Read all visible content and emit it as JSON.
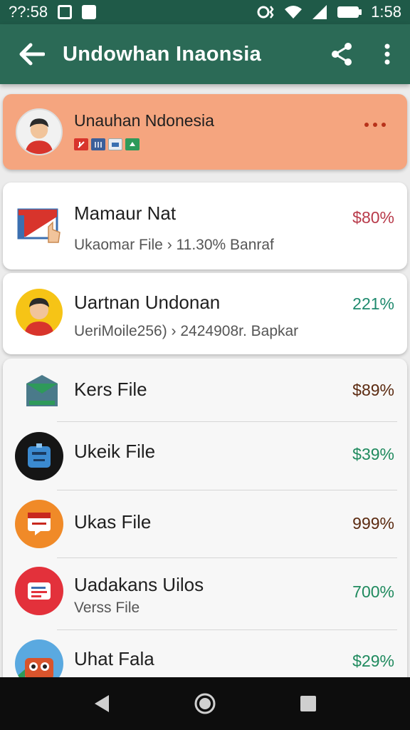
{
  "status_bar": {
    "time_left": "??:58",
    "time_right": "1:58"
  },
  "app_bar": {
    "title": "Undowhan Inaonsia"
  },
  "highlight": {
    "title": "Unauhan Ndonesia"
  },
  "rows": [
    {
      "title": "Mamaur Nat",
      "subtitle": "Ukaomar File › 11.30% Banraf",
      "value": "$80%",
      "value_color": "#b83a4a"
    },
    {
      "title": "Uartnan Undonan",
      "subtitle": "UeriMoile256) › 2424908r. Bapkar",
      "value": "221%",
      "value_color": "#1f8a6e"
    }
  ],
  "list": [
    {
      "title": "Kers File",
      "value": "$89%",
      "value_color": "#5b2a10"
    },
    {
      "title": "Ukeik File",
      "value": "$39%",
      "value_color": "#1f8a5e"
    },
    {
      "title": "Ukas File",
      "value": "999%",
      "value_color": "#5b2a10"
    },
    {
      "title": "Uadakans Uilos",
      "subtitle": "Verss File",
      "value": "700%",
      "value_color": "#1f8a5e"
    },
    {
      "title": "Uhat Fala",
      "value": "$29%",
      "value_color": "#1f8a5e"
    }
  ],
  "colors": {
    "primary": "#2b6a56",
    "status": "#1f5a48",
    "highlight": "#f5a57f"
  },
  "icons": [
    "back-arrow-icon",
    "share-icon",
    "more-vert-icon",
    "more-horiz-icon",
    "nav-back-icon",
    "nav-home-icon",
    "nav-recents-icon"
  ]
}
